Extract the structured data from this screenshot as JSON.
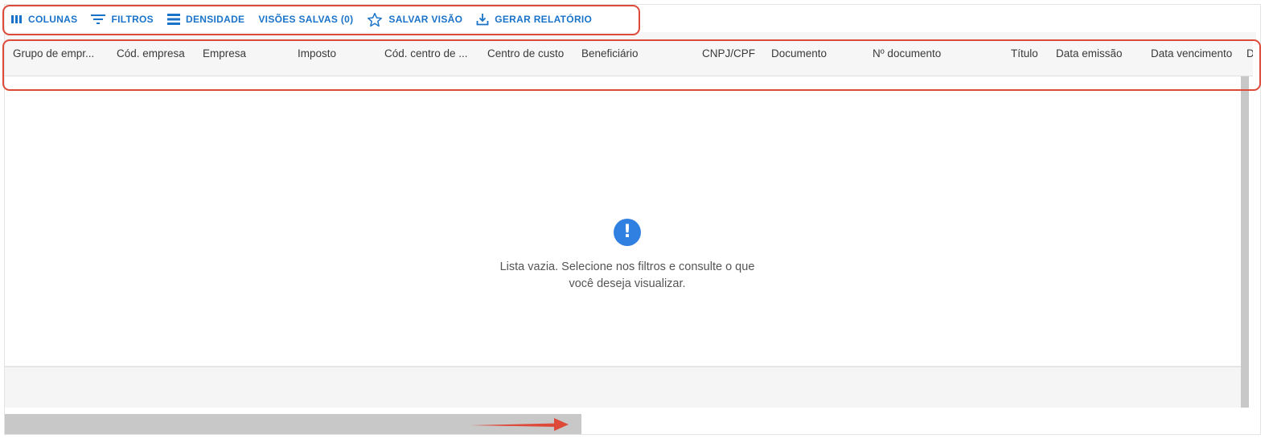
{
  "toolbar": {
    "columns_label": "COLUNAS",
    "filters_label": "FILTROS",
    "density_label": "DENSIDADE",
    "saved_views_label": "VISÕES SALVAS (0)",
    "save_view_label": "SALVAR VISÃO",
    "report_label": "GERAR RELATÓRIO"
  },
  "columns": [
    "Grupo de empr...",
    "Cód. empresa",
    "Empresa",
    "Imposto",
    "Cód. centro de ...",
    "Centro de custo",
    "Beneficiário",
    "CNPJ/CPF",
    "Documento",
    "Nº documento",
    "Título",
    "Data emissão",
    "Data vencimento",
    "D"
  ],
  "empty_state": {
    "icon": "exclamation-icon",
    "line1": "Lista vazia. Selecione nos filtros e consulte o que",
    "line2": "você deseja visualizar."
  },
  "colors": {
    "accent": "#1a73c9",
    "info_icon": "#2f80e0",
    "annotation": "#dd4a3a"
  }
}
